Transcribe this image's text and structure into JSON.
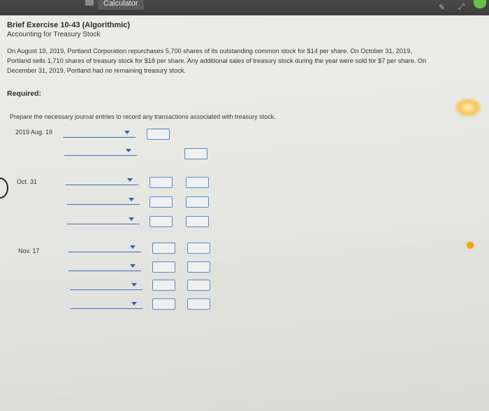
{
  "toolbar": {
    "calculator_label": "Calculator"
  },
  "exercise": {
    "title": "Brief Exercise 10-43 (Algorithmic)",
    "subtitle": "Accounting for Treasury Stock",
    "problem_line1": "On August 19, 2019, Portland Corporation repurchases 5,700 shares of its outstanding common stock for $14 per share. On October 31, 2019,",
    "problem_line2": "Portland sells 1,710 shares of treasury stock for $18 per share. Any additional sales of treasury stock during the year were sold for $7 per share. On",
    "problem_line3": "December 31, 2019, Portland had no remaining treasury stock.",
    "required_label": "Required:",
    "instructions": "Prepare the necessary journal entries to record any transactions associated with treasury stock."
  },
  "journal": {
    "entries": [
      {
        "date": "2019 Aug. 19",
        "rows": 2
      },
      {
        "date": "Oct. 31",
        "rows": 3
      },
      {
        "date": "Nov. 17",
        "rows": 4
      }
    ]
  },
  "colors": {
    "accent": "#3a6fb8",
    "caret": "#2f63b0",
    "topbar": "#3b3b3b",
    "orange": "#f4a21a"
  }
}
